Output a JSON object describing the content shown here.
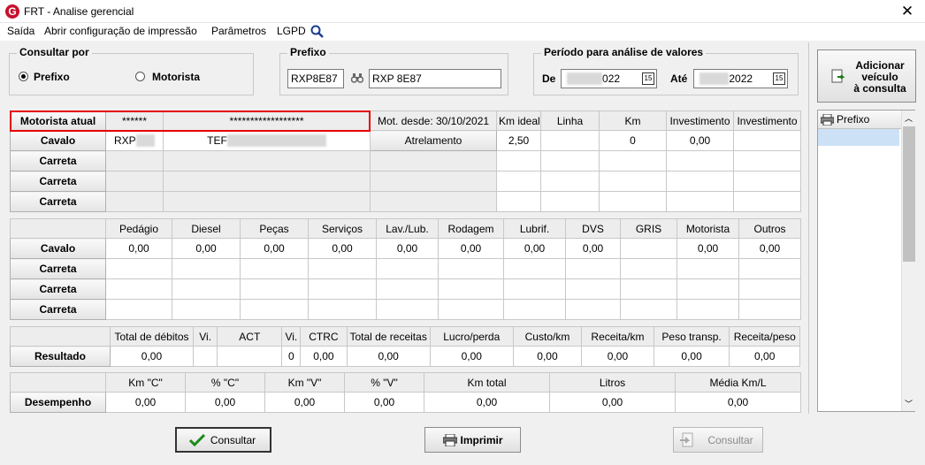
{
  "window": {
    "title": "FRT - Analise gerencial",
    "icon_letter": "G",
    "close": "✕"
  },
  "menu": [
    "Saída",
    "Abrir configuração de impressão",
    "Parâmetros",
    "LGPD"
  ],
  "consultar_por": {
    "legend": "Consultar por",
    "opt1": "Prefixo",
    "opt2": "Motorista"
  },
  "prefixo": {
    "legend": "Prefixo",
    "code": "RXP8E87",
    "display": "RXP 8E87"
  },
  "periodo": {
    "legend": "Período para análise de valores",
    "de_label": "De",
    "de_year": "022",
    "ate_label": "Até",
    "ate_year": "2022"
  },
  "add_button": {
    "line1": "Adicionar",
    "line2": "veículo",
    "line3": "à consulta"
  },
  "t1": {
    "label": "Motorista atual",
    "mask1": "******",
    "mask2": "******************",
    "mot_desde": "Mot. desde: 30/10/2021",
    "headers": [
      "Km ideal",
      "Linha",
      "Km",
      "Investimento",
      "Investimento"
    ],
    "rows": [
      "Cavalo",
      "Carreta",
      "Carreta",
      "Carreta"
    ],
    "cav_prefix": "RXP",
    "cav_name": "TEF",
    "cav_status": "Atrelamento",
    "cav_vals": [
      "2,50",
      "",
      "0",
      "0,00",
      ""
    ]
  },
  "t2": {
    "headers": [
      "Pedágio",
      "Diesel",
      "Peças",
      "Serviços",
      "Lav./Lub.",
      "Rodagem",
      "Lubrif.",
      "DVS",
      "GRIS",
      "Motorista",
      "Outros"
    ],
    "rows": [
      "Cavalo",
      "Carreta",
      "Carreta",
      "Carreta"
    ],
    "cav_vals": [
      "0,00",
      "0,00",
      "0,00",
      "0,00",
      "0,00",
      "0,00",
      "0,00",
      "0,00",
      "",
      "0,00",
      "0,00"
    ]
  },
  "t3": {
    "headers": [
      "Total de débitos",
      "Vi.",
      "ACT",
      "Vi.",
      "CTRC",
      "Total de receitas",
      "Lucro/perda",
      "Custo/km",
      "Receita/km",
      "Peso transp.",
      "Receita/peso"
    ],
    "row": "Resultado",
    "vals": [
      "0,00",
      "",
      "",
      "0",
      "0,00",
      "0,00",
      "0,00",
      "0,00",
      "0,00",
      "0,00",
      "0,00"
    ]
  },
  "t4": {
    "headers": [
      "Km \"C\"",
      "% \"C\"",
      "Km \"V\"",
      "% \"V\"",
      "Km total",
      "Litros",
      "Média Km/L"
    ],
    "row": "Desempenho",
    "vals": [
      "0,00",
      "0,00",
      "0,00",
      "0,00",
      "0,00",
      "0,00",
      "0,00"
    ]
  },
  "right_panel": {
    "header": "Prefixo"
  },
  "buttons": {
    "consultar": "Consultar",
    "imprimir": "Imprimir",
    "consultar2": "Consultar"
  }
}
